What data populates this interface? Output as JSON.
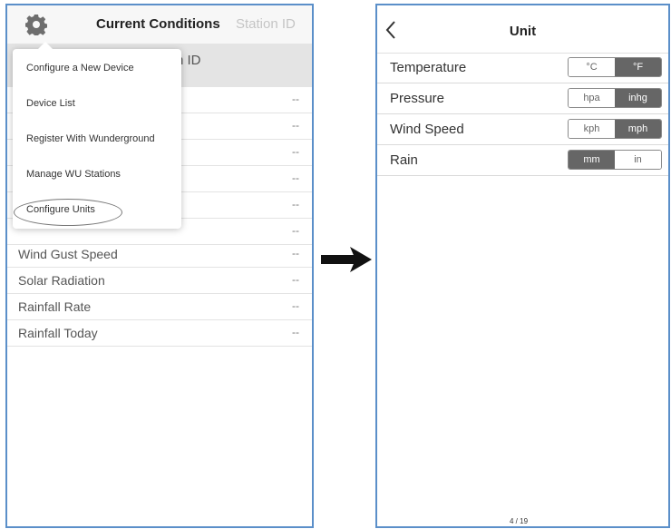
{
  "left": {
    "title": "Current Conditions",
    "station": "Station ID",
    "subheader_text": "n ID",
    "rows": [
      {
        "label": "",
        "value": "--"
      },
      {
        "label": "",
        "value": "--"
      },
      {
        "label": "",
        "value": "--"
      },
      {
        "label": "",
        "value": "--"
      },
      {
        "label": "",
        "value": "--"
      },
      {
        "label": "",
        "value": "--"
      },
      {
        "label": "Wind Gust Speed",
        "value": "--"
      },
      {
        "label": "Solar Radiation",
        "value": "--"
      },
      {
        "label": "Rainfall Rate",
        "value": "--"
      },
      {
        "label": "Rainfall Today",
        "value": "--"
      }
    ],
    "menu": [
      "Configure a New Device",
      "Device List",
      "Register With Wunderground",
      "Manage WU Stations",
      "Configure Units"
    ]
  },
  "right": {
    "title": "Unit",
    "rows": [
      {
        "label": "Temperature",
        "options": [
          "°C",
          "°F"
        ],
        "selected": 1
      },
      {
        "label": "Pressure",
        "options": [
          "hpa",
          "inhg"
        ],
        "selected": 1
      },
      {
        "label": "Wind Speed",
        "options": [
          "kph",
          "mph"
        ],
        "selected": 1
      },
      {
        "label": "Rain",
        "options": [
          "mm",
          "in"
        ],
        "selected": 0
      }
    ],
    "page": "4 / 19"
  },
  "colors": {
    "frame": "#5b8fc9",
    "segment_selected": "#666666"
  }
}
